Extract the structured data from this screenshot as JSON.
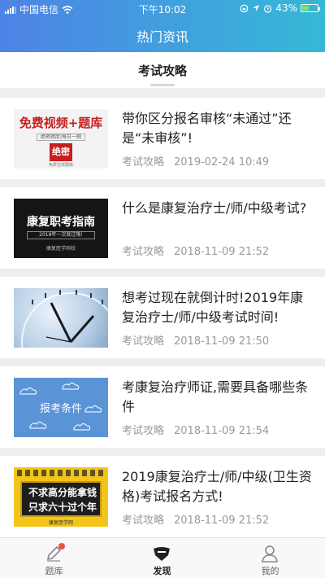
{
  "status_bar": {
    "carrier": "中国电信",
    "time": "下午10:02",
    "battery": "43%",
    "battery_level": 0.43
  },
  "navbar": {
    "title": "热门资讯"
  },
  "tabs": [
    {
      "label": "考试攻略",
      "active": true
    }
  ],
  "articles": [
    {
      "title": "带你区分报名审核“未通过”还是“未审核”!",
      "category": "考试攻略",
      "date": "2019-02-24 10:49",
      "thumb_text": [
        "免费视频+题库",
        "绝密题库|每日一刷",
        "绝密",
        "免费在线题库"
      ]
    },
    {
      "title": "什么是康复治疗士/师/中级考试?",
      "category": "考试攻略",
      "date": "2018-11-09 21:52",
      "thumb_text": [
        "康复职考指南",
        "2018年一次就过哦!",
        "康复医学网校"
      ]
    },
    {
      "title": "想考过现在就倒计时!2019年康复治疗士/师/中级考试时间!",
      "category": "考试攻略",
      "date": "2018-11-09 21:50",
      "thumb_text": []
    },
    {
      "title": "考康复治疗师证,需要具备哪些条件",
      "category": "考试攻略",
      "date": "2018-11-09 21:54",
      "thumb_text": [
        "报考条件"
      ]
    },
    {
      "title": "2019康复治疗士/师/中级(卫生资格)考试报名方式!",
      "category": "考试攻略",
      "date": "2018-11-09 21:52",
      "thumb_text": [
        "不求高分能拿钱",
        "只求六十过个年",
        "康复医学网"
      ]
    }
  ],
  "bottom_nav": [
    {
      "label": "题库",
      "icon": "pencil-icon",
      "badge": true
    },
    {
      "label": "发现",
      "icon": "discover-icon",
      "active": true
    },
    {
      "label": "我的",
      "icon": "user-icon"
    }
  ],
  "colors": {
    "header_start": "#4e83e6",
    "header_end": "#35b9d6",
    "badge": "#ef4f44"
  }
}
